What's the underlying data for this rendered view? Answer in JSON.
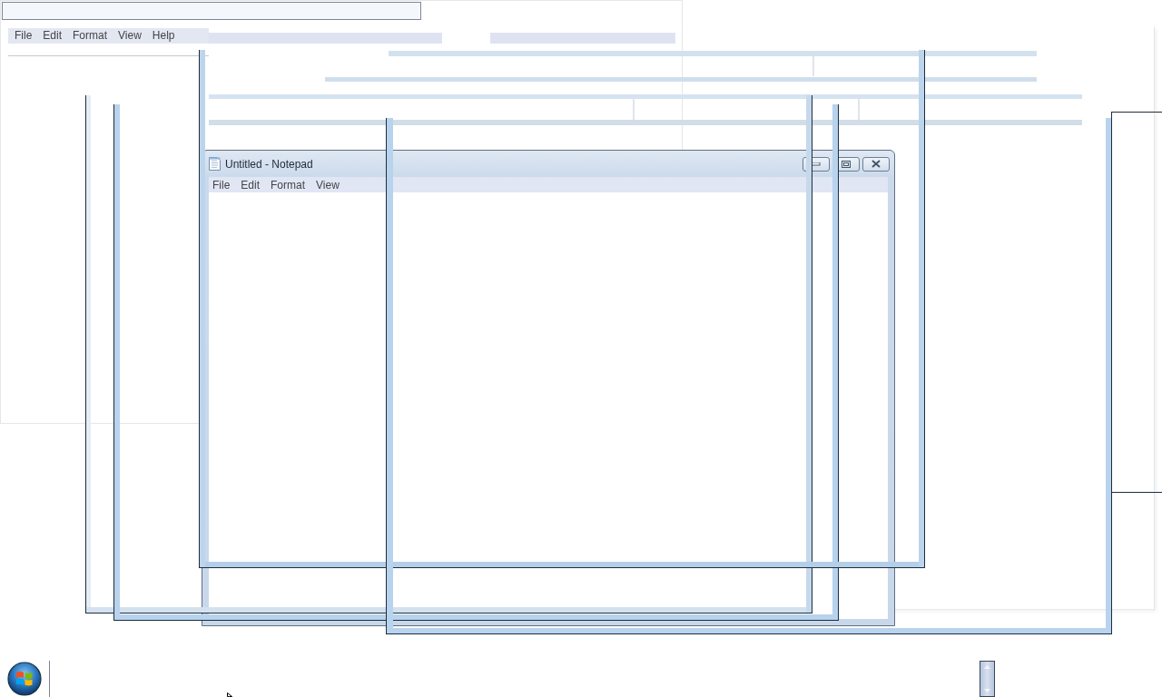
{
  "background_window": {
    "menu": [
      "File",
      "Edit",
      "Format",
      "View",
      "Help"
    ]
  },
  "notepad": {
    "title": "Untitled - Notepad",
    "menu": [
      "File",
      "Edit",
      "Format",
      "View"
    ]
  }
}
